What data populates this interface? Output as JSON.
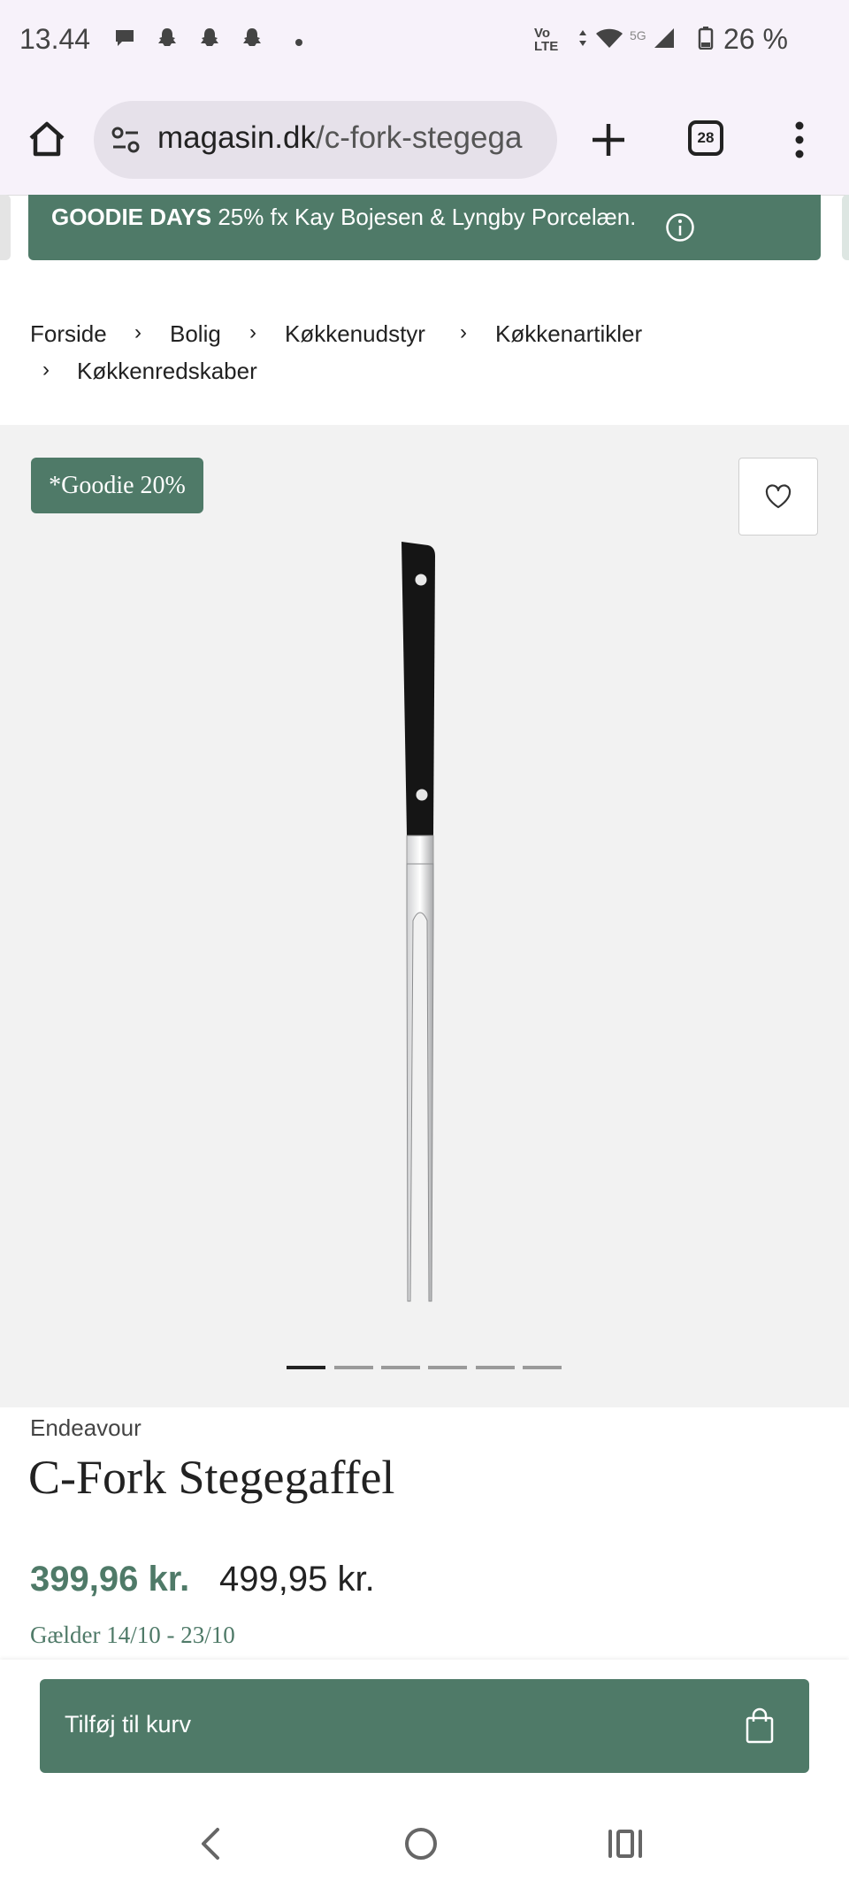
{
  "status_bar": {
    "time": "13.44",
    "network_label": "Vo LTE",
    "fiveg_label": "5G",
    "battery": "26 %"
  },
  "browser": {
    "url_domain": "magasin.dk",
    "url_path": "/c-fork-stegega",
    "tab_count": "28"
  },
  "promo": {
    "bold": "GOODIE DAYS",
    "text": "25% fx Kay Bojesen & Lyngby Porcelæn."
  },
  "breadcrumb": {
    "items": [
      "Forside",
      "Bolig",
      "Køkkenudstyr",
      "Køkkenartikler",
      "Køkkenredskaber"
    ],
    "separator": "›"
  },
  "gallery": {
    "badge": "*Goodie 20%",
    "slides_count": 6,
    "active_slide": 1
  },
  "product": {
    "brand": "Endeavour",
    "title": "C-Fork Stegegaffel",
    "price_sale": "399,96 kr.",
    "price_original": "499,95 kr.",
    "valid_text": "Gælder 14/10 - 23/10"
  },
  "cart": {
    "button_label": "Tilføj til kurv"
  },
  "colors": {
    "accent": "#4f7a68",
    "gallery_bg": "#f2f2f2"
  }
}
